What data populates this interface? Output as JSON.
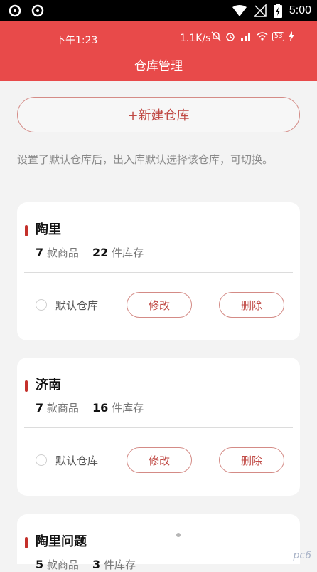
{
  "system_bar": {
    "time": "5:00",
    "left_icons": [
      "sync-icon",
      "sync-icon"
    ],
    "right_icons": [
      "wifi-icon",
      "no-signal-icon",
      "battery-icon"
    ]
  },
  "app_status": {
    "time": "下午1:23",
    "net_speed": "1.1K/s",
    "icons": [
      "mute-icon",
      "alarm-icon",
      "signal-icon",
      "wifi-icon",
      "battery-icon",
      "charging-icon"
    ],
    "battery_level": "53"
  },
  "header": {
    "title": "仓库管理"
  },
  "new_button": {
    "label": "+新建仓库"
  },
  "hint": "设置了默认仓库后，出入库默认选择该仓库，可切换。",
  "labels": {
    "products_unit": "款商品",
    "stock_unit": "件库存",
    "default_label": "默认仓库",
    "edit": "修改",
    "delete": "删除"
  },
  "warehouses": [
    {
      "name": "陶里",
      "products": "7",
      "stock": "22"
    },
    {
      "name": "济南",
      "products": "7",
      "stock": "16"
    },
    {
      "name": "陶里问题",
      "products": "5",
      "stock": "3"
    }
  ],
  "watermark": "pc6"
}
